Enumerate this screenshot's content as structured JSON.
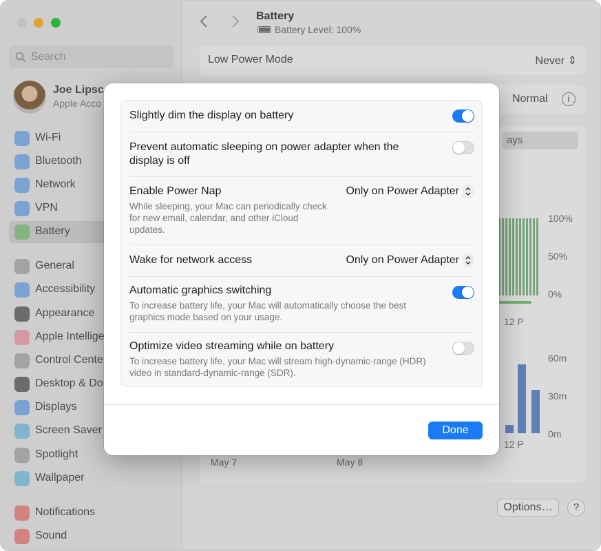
{
  "sidebar": {
    "search_placeholder": "Search",
    "profile": {
      "name": "Joe Lipsc",
      "subtitle": "Apple Acco"
    },
    "items": [
      {
        "label": "Wi-Fi",
        "icon": "wifi-icon",
        "color": "#3b8ef0"
      },
      {
        "label": "Bluetooth",
        "icon": "bluetooth-icon",
        "color": "#3b8ef0"
      },
      {
        "label": "Network",
        "icon": "globe-icon",
        "color": "#3b8ef0"
      },
      {
        "label": "VPN",
        "icon": "vpn-icon",
        "color": "#3b8ef0"
      },
      {
        "label": "Battery",
        "icon": "battery-icon",
        "color": "#5ec35a"
      },
      {
        "label": "General",
        "icon": "gear-icon",
        "color": "#8e8e93"
      },
      {
        "label": "Accessibility",
        "icon": "accessibility-icon",
        "color": "#3b8ef0"
      },
      {
        "label": "Appearance",
        "icon": "appearance-icon",
        "color": "#1d1d1f"
      },
      {
        "label": "Apple Intellige",
        "icon": "apple-intelligence-icon",
        "color": "#f07a8a"
      },
      {
        "label": "Control Cente",
        "icon": "control-center-icon",
        "color": "#8e8e93"
      },
      {
        "label": "Desktop & Do",
        "icon": "desktop-dock-icon",
        "color": "#1d1d1f"
      },
      {
        "label": "Displays",
        "icon": "displays-icon",
        "color": "#3b8ef0"
      },
      {
        "label": "Screen Saver",
        "icon": "screen-saver-icon",
        "color": "#49b5e8"
      },
      {
        "label": "Spotlight",
        "icon": "spotlight-icon",
        "color": "#8e8e93"
      },
      {
        "label": "Wallpaper",
        "icon": "wallpaper-icon",
        "color": "#49b5e8"
      },
      {
        "label": "Notifications",
        "icon": "notifications-icon",
        "color": "#ef4b4b"
      },
      {
        "label": "Sound",
        "icon": "sound-icon",
        "color": "#ef4b4b"
      }
    ]
  },
  "main": {
    "title": "Battery",
    "subtitle": "Battery Level: 100%",
    "low_power_label": "Low Power Mode",
    "low_power_value": "Never",
    "energy_value": "Normal",
    "segment_label": "ays",
    "level_ticks": [
      "100%",
      "50%",
      "0%"
    ],
    "usage_ticks": [
      "60m",
      "30m",
      "0m"
    ],
    "time_label_top": "12 P",
    "time_label_bottom": "12 P",
    "dates": [
      "May 7",
      "May 8"
    ],
    "options_button": "Options…",
    "help_button": "?"
  },
  "sheet": {
    "rows": [
      {
        "label": "Slightly dim the display on battery",
        "toggle": true
      },
      {
        "label": "Prevent automatic sleeping on power adapter when the display is off",
        "toggle": false
      },
      {
        "label": "Enable Power Nap",
        "description": "While sleeping, your Mac can periodically check for new email, calendar, and other iCloud updates.",
        "popup": "Only on Power Adapter"
      },
      {
        "label": "Wake for network access",
        "popup": "Only on Power Adapter"
      },
      {
        "label": "Automatic graphics switching",
        "description": "To increase battery life, your Mac will automatically choose the best graphics mode based on your usage.",
        "toggle": true
      },
      {
        "label": "Optimize video streaming while on battery",
        "description": "To increase battery life, your Mac will stream high-dynamic-range (HDR) video in standard-dynamic-range (SDR).",
        "toggle": false
      }
    ],
    "done_button": "Done"
  },
  "colors": {
    "accent": "#1a7cf5",
    "toggle_off": "#e0e0e0"
  }
}
